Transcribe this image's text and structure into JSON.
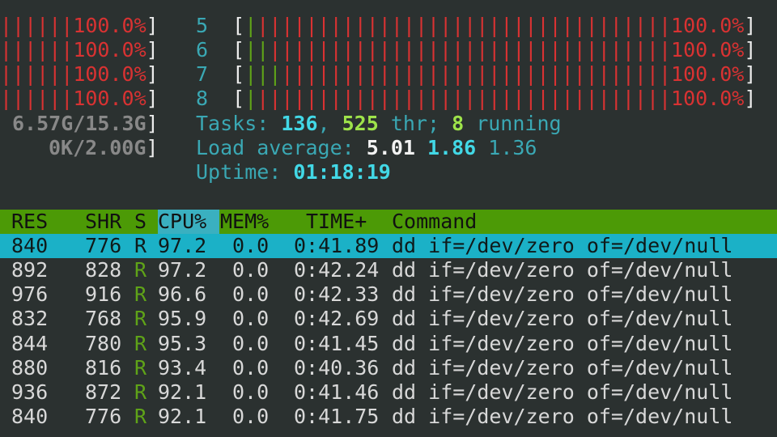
{
  "left_meters": [
    {
      "bars": "||||||",
      "value": "100.0%",
      "close": "]"
    },
    {
      "bars": "||||||",
      "value": "100.0%",
      "close": "]"
    },
    {
      "bars": "||||||",
      "value": "100.0%",
      "close": "]"
    },
    {
      "bars": "||||||",
      "value": "100.0%",
      "close": "]"
    }
  ],
  "mem": {
    "value": "6.57G/15.3G",
    "close": "]"
  },
  "swp": {
    "value": "0K/2.00G",
    "close": "]"
  },
  "right_meters": [
    {
      "cpu": "5",
      "open": "[",
      "green_bars": "|",
      "red_bars": "||||||||||||||||||||||||||||||||||",
      "value": "100.0%",
      "close": "]"
    },
    {
      "cpu": "6",
      "open": "[",
      "green_bars": "||",
      "red_bars": "|||||||||||||||||||||||||||||||||",
      "value": "100.0%",
      "close": "]"
    },
    {
      "cpu": "7",
      "open": "[",
      "green_bars": "|||",
      "red_bars": "||||||||||||||||||||||||||||||||",
      "value": "100.0%",
      "close": "]"
    },
    {
      "cpu": "8",
      "open": "[",
      "green_bars": "|",
      "red_bars": "||||||||||||||||||||||||||||||||||",
      "value": "100.0%",
      "close": "]"
    }
  ],
  "tasks": {
    "label": "Tasks: ",
    "count": "136",
    "sep": ", ",
    "threads": "525",
    "thr_label": " thr; ",
    "running": "8",
    "running_label": " running"
  },
  "load": {
    "label": "Load average: ",
    "v1": "5.01",
    "v5": "1.86",
    "v15": "1.36"
  },
  "uptime": {
    "label": "Uptime: ",
    "value": "01:18:19"
  },
  "columns": {
    "res": "RES",
    "shr": "SHR",
    "s": "S",
    "cpu": "CPU%",
    "mem": "MEM%",
    "time": "TIME+",
    "command": "Command"
  },
  "processes": [
    {
      "res": "840",
      "shr": "776",
      "s": "R",
      "cpu": "97.2",
      "mem": "0.0",
      "time": "0:41.89",
      "command": "dd if=/dev/zero of=/dev/null"
    },
    {
      "res": "892",
      "shr": "828",
      "s": "R",
      "cpu": "97.2",
      "mem": "0.0",
      "time": "0:42.24",
      "command": "dd if=/dev/zero of=/dev/null"
    },
    {
      "res": "976",
      "shr": "916",
      "s": "R",
      "cpu": "96.6",
      "mem": "0.0",
      "time": "0:42.33",
      "command": "dd if=/dev/zero of=/dev/null"
    },
    {
      "res": "832",
      "shr": "768",
      "s": "R",
      "cpu": "95.9",
      "mem": "0.0",
      "time": "0:42.69",
      "command": "dd if=/dev/zero of=/dev/null"
    },
    {
      "res": "844",
      "shr": "780",
      "s": "R",
      "cpu": "95.3",
      "mem": "0.0",
      "time": "0:41.45",
      "command": "dd if=/dev/zero of=/dev/null"
    },
    {
      "res": "880",
      "shr": "816",
      "s": "R",
      "cpu": "93.4",
      "mem": "0.0",
      "time": "0:40.36",
      "command": "dd if=/dev/zero of=/dev/null"
    },
    {
      "res": "936",
      "shr": "872",
      "s": "R",
      "cpu": "92.1",
      "mem": "0.0",
      "time": "0:41.46",
      "command": "dd if=/dev/zero of=/dev/null"
    },
    {
      "res": "840",
      "shr": "776",
      "s": "R",
      "cpu": "92.1",
      "mem": "0.0",
      "time": "0:41.75",
      "command": "dd if=/dev/zero of=/dev/null"
    }
  ],
  "colors": {
    "background": "#2b3130",
    "header": "#4c9a06",
    "selected": "#1bb1c7",
    "bar_red": "#d93232",
    "bar_green": "#5fa318",
    "cyan": "#3aa8b4"
  }
}
